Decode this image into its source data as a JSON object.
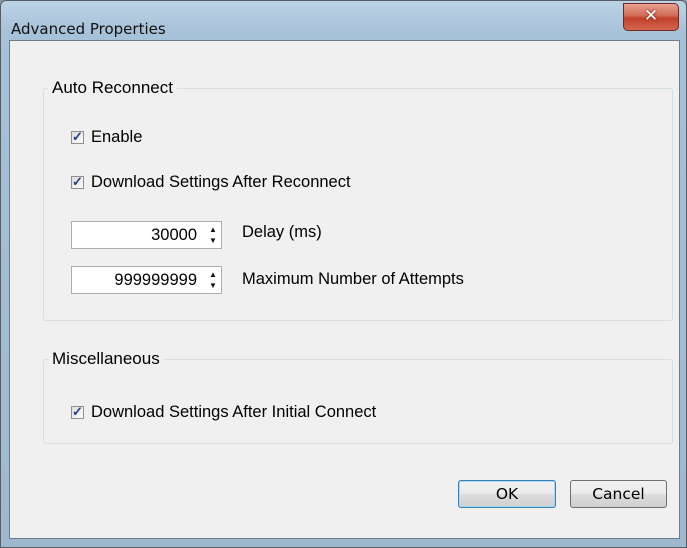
{
  "window": {
    "title": "Advanced Properties",
    "close_icon": "close-icon"
  },
  "auto_reconnect": {
    "title": "Auto Reconnect",
    "enable": {
      "label": "Enable",
      "checked": true
    },
    "download_after_reconnect": {
      "label": "Download Settings After Reconnect",
      "checked": true
    },
    "delay": {
      "value": "30000",
      "label": "Delay (ms)"
    },
    "max_attempts": {
      "value": "999999999",
      "label": "Maximum Number of Attempts"
    }
  },
  "miscellaneous": {
    "title": "Miscellaneous",
    "download_after_initial": {
      "label": "Download Settings After Initial Connect",
      "checked": true
    }
  },
  "buttons": {
    "ok": "OK",
    "cancel": "Cancel"
  },
  "colors": {
    "close_button": "#c0402a",
    "checkmark": "#243c8a",
    "default_button_border": "#3c7fb1"
  }
}
